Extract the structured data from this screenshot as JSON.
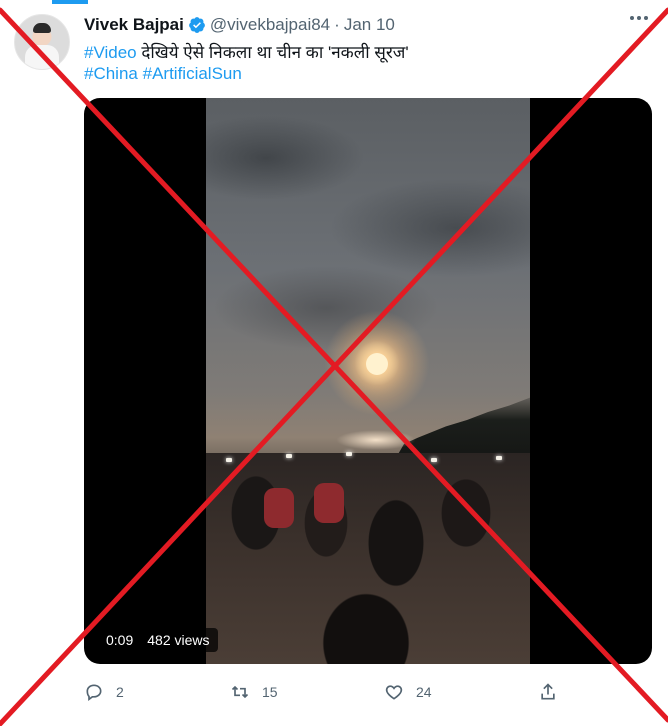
{
  "tweet": {
    "author_name": "Vivek Bajpai",
    "handle": "@vivekbajpai84",
    "separator": "·",
    "date": "Jan 10",
    "line1": {
      "hashtag": "#Video",
      "text": " देखिये ऐसे निकला था चीन का 'नकली सूरज'"
    },
    "line2": {
      "hashtag1": "#China",
      "hashtag2": "#ArtificialSun"
    }
  },
  "video": {
    "time": "0:09",
    "views": "482 views"
  },
  "actions": {
    "reply_count": "2",
    "retweet_count": "15",
    "like_count": "24"
  },
  "icons": {
    "verified": "verified-badge-icon",
    "more": "more-options-icon",
    "reply": "reply-icon",
    "retweet": "retweet-icon",
    "like": "like-icon",
    "share": "share-icon"
  },
  "colors": {
    "accent": "#1d9bf0",
    "muted": "#536471",
    "cross": "#e31b23"
  }
}
